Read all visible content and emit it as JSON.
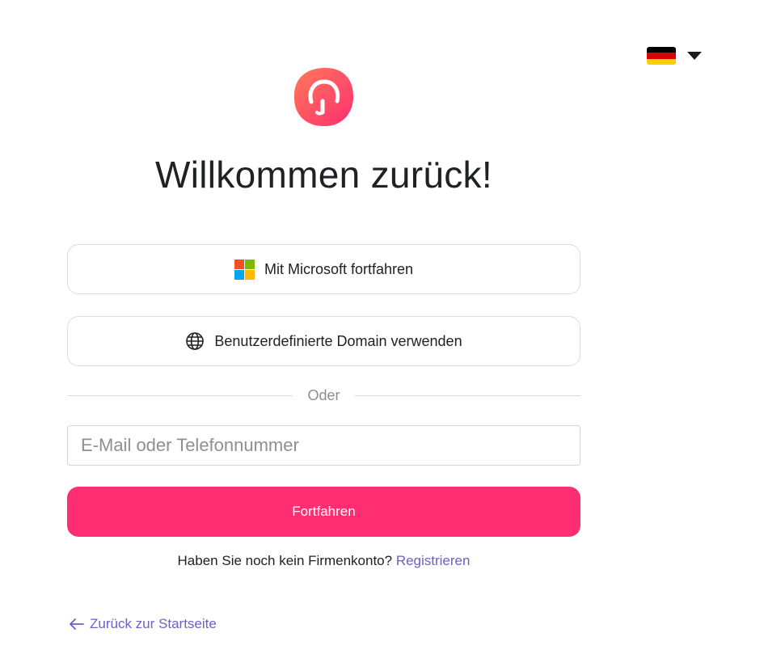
{
  "language": {
    "flag_colors": [
      "#000000",
      "#dd0000",
      "#ffce00"
    ],
    "icon": "germany-flag-icon"
  },
  "brand": {
    "logo_icon": "brand-logo-icon",
    "gradient_from": "#ff5a5f",
    "gradient_to": "#ff2d72"
  },
  "page": {
    "title": "Willkommen zurück!"
  },
  "sso": {
    "microsoft_label": "Mit Microsoft fortfahren",
    "domain_label": "Benutzerdefinierte Domain verwenden"
  },
  "divider": {
    "text": "Oder"
  },
  "form": {
    "email_placeholder": "E-Mail oder Telefonnummer",
    "email_value": "",
    "submit_label": "Fortfahren"
  },
  "register": {
    "prompt": "Haben Sie noch kein Firmenkonto?",
    "link_label": "Registrieren"
  },
  "back": {
    "label": "Zurück zur Startseite"
  },
  "colors": {
    "accent": "#ff2d72",
    "link": "#6e5fc5"
  }
}
